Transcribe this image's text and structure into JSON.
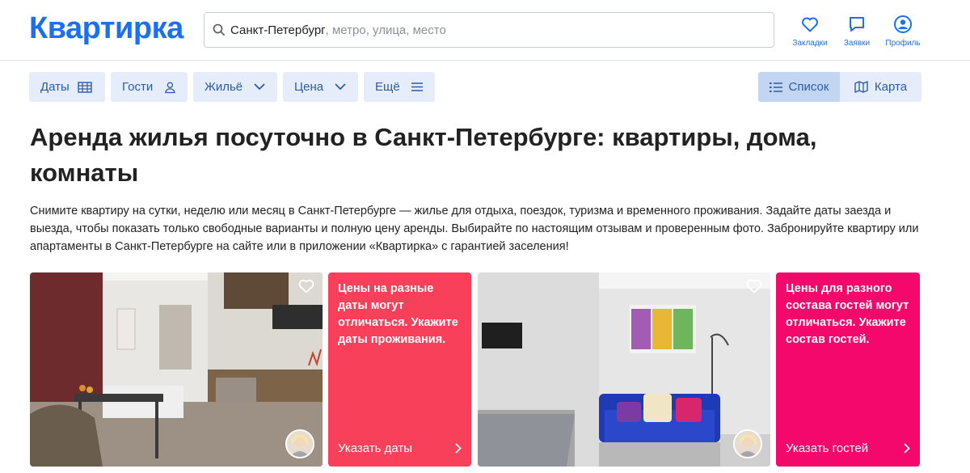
{
  "header": {
    "logo": "Квартирка",
    "search_value": "Санкт-Петербург",
    "search_placeholder": ", метро, улица, место",
    "bookmarks_label": "Закладки",
    "requests_label": "Заявки",
    "profile_label": "Профиль"
  },
  "filters": {
    "dates": "Даты",
    "guests": "Гости",
    "housing": "Жильё",
    "price": "Цена",
    "more": "Ещё",
    "list_view": "Список",
    "map_view": "Карта"
  },
  "main": {
    "title": "Аренда жилья посуточно в Санкт-Петербурге: квартиры, дома, комнаты",
    "description": "Снимите квартиру на сутки, неделю или месяц в Санкт-Петербурге — жилье для отдыха, поездок, туризма и временного проживания. Задайте даты заезда и выезда, чтобы показать только свободные варианты и полную цену аренды. Выбирайте по настоящим отзывам и проверенным фото. Забронируйте квартиру или апартаменты в Санкт-Петербурге на сайте или в приложении «Квартирка» с гарантией заселения!"
  },
  "cards": {
    "promo_dates": {
      "text": "Цены на разные даты могут отличаться. Укажите даты проживания.",
      "link": "Указать даты",
      "color": "#f8405a"
    },
    "promo_guests": {
      "text": "Цены для разного состава гостей могут отличаться. Укажите состав гостей.",
      "link": "Указать гостей",
      "color": "#f5086c"
    }
  },
  "colors": {
    "brand": "#1b6ff0",
    "filter_bg": "#e4edf9",
    "filter_text": "#2c5ba8"
  }
}
